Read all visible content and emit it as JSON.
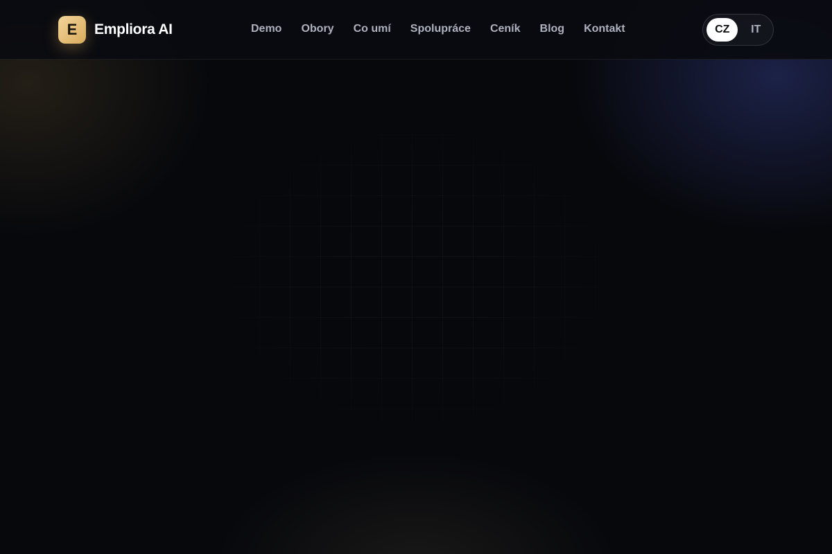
{
  "brand": {
    "logo_letter": "E",
    "name": "Empliora AI",
    "accent": "#e6bf78"
  },
  "nav": {
    "items": [
      {
        "label": "Demo"
      },
      {
        "label": "Obory"
      },
      {
        "label": "Co umí"
      },
      {
        "label": "Spolupráce"
      },
      {
        "label": "Ceník"
      },
      {
        "label": "Blog"
      },
      {
        "label": "Kontakt"
      }
    ]
  },
  "language": {
    "options": [
      "CZ",
      "IT"
    ],
    "selected": "CZ"
  },
  "colors": {
    "background": "#07080c",
    "nav_text": "#aeb2bf"
  }
}
